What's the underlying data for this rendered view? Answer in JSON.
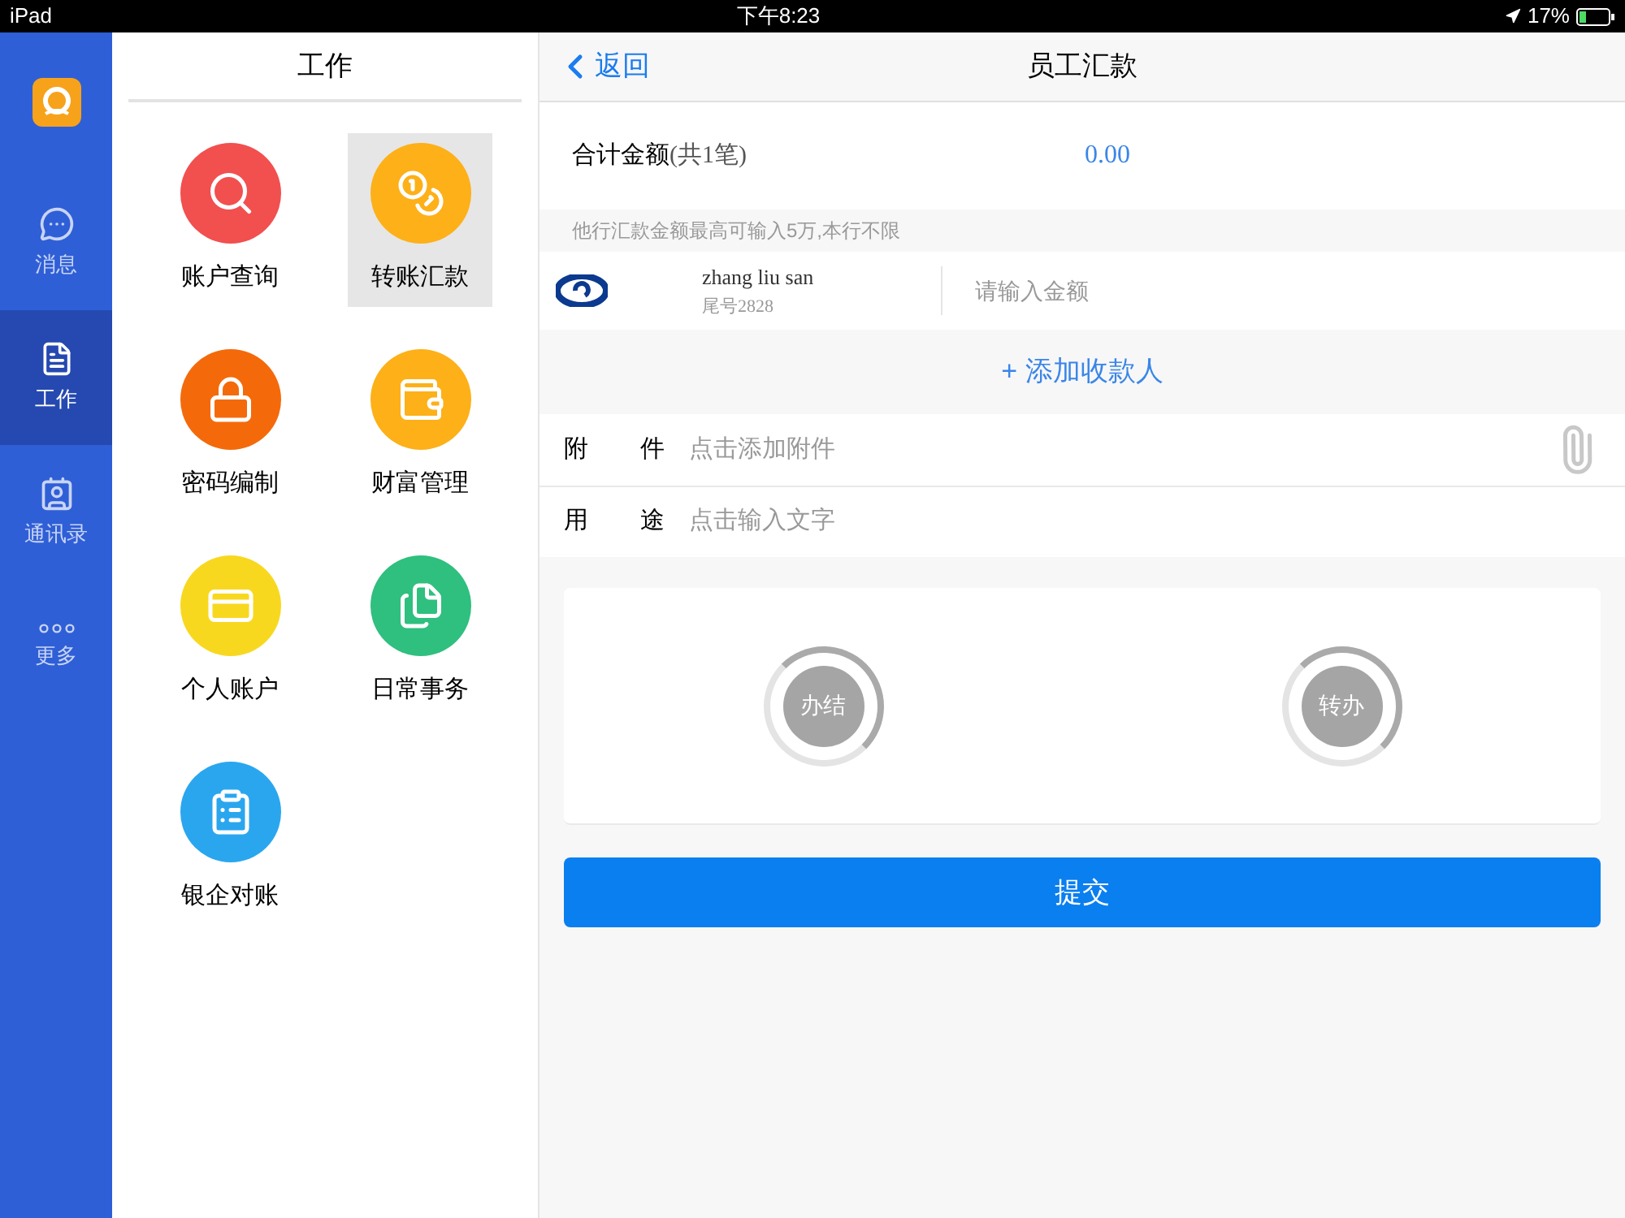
{
  "status_bar": {
    "device": "iPad",
    "time": "下午8:23",
    "battery": "17%"
  },
  "sidebar": {
    "items": [
      {
        "label": "消息",
        "kind": "chat",
        "selected": false
      },
      {
        "label": "工作",
        "kind": "work",
        "selected": true
      },
      {
        "label": "通讯录",
        "kind": "contacts",
        "selected": false
      },
      {
        "label": "更多",
        "kind": "more",
        "selected": false
      }
    ]
  },
  "work_panel": {
    "title": "工作",
    "items": [
      {
        "label": "账户查询",
        "kind": "search",
        "color": "#f24f4f",
        "selected": false
      },
      {
        "label": "转账汇款",
        "kind": "transfer",
        "color": "#fdb018",
        "selected": true
      },
      {
        "label": "密码编制",
        "kind": "lock",
        "color": "#f46a0a",
        "selected": false
      },
      {
        "label": "财富管理",
        "kind": "wallet",
        "color": "#fdb018",
        "selected": false
      },
      {
        "label": "个人账户",
        "kind": "card",
        "color": "#f8d81f",
        "selected": false
      },
      {
        "label": "日常事务",
        "kind": "document",
        "color": "#2fbf7f",
        "selected": false
      },
      {
        "label": "银企对账",
        "kind": "clipboard",
        "color": "#2aa6ef",
        "selected": false
      }
    ]
  },
  "header": {
    "back": "返回",
    "title": "员工汇款"
  },
  "total": {
    "label": "合计金额",
    "count": "(共1笔)",
    "amount": "0.00"
  },
  "note": "他行汇款金额最高可输入5万,本行不限",
  "payee": {
    "name": "zhang liu san",
    "tail": "尾号2828",
    "amount_placeholder": "请输入金额"
  },
  "add_payee": "+ 添加收款人",
  "fields": [
    {
      "label": "附 件",
      "placeholder": "点击添加附件",
      "kind": "attachment"
    },
    {
      "label": "用 途",
      "placeholder": "点击输入文字",
      "kind": "text"
    }
  ],
  "actions": [
    "办结",
    "转办"
  ],
  "submit": "提交"
}
